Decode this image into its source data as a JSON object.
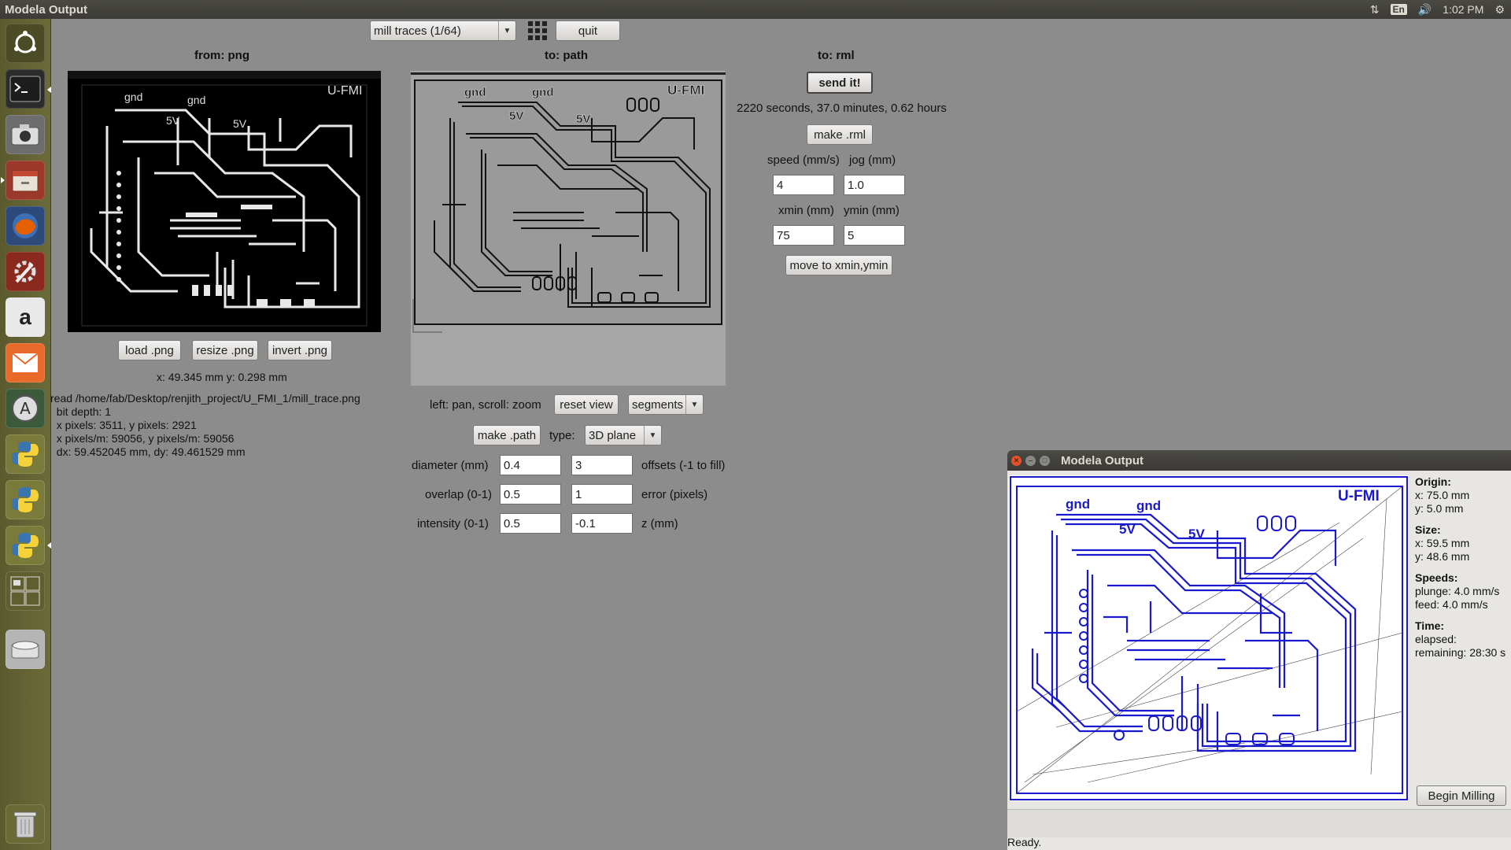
{
  "topbar": {
    "window_title": "Modela Output",
    "network_icon": "network-icon",
    "keyboard_layout": "En",
    "volume_icon": "volume-icon",
    "clock": "1:02 PM",
    "gear_icon": "gear-icon"
  },
  "launcher": {
    "items": [
      "dash-home",
      "terminal",
      "screenshot",
      "files",
      "firefox",
      "system-settings",
      "amazon",
      "mail",
      "software-updater",
      "python",
      "python",
      "python",
      "workspace-switcher",
      "drive",
      "trash"
    ]
  },
  "toolbar": {
    "process_select": "mill traces (1/64)",
    "quit_label": "quit"
  },
  "from_png": {
    "heading": "from: png",
    "load_label": "load .png",
    "resize_label": "resize .png",
    "invert_label": "invert .png",
    "coords": "x: 49.345 mm  y: 0.298 mm",
    "file_info": [
      "read /home/fab/Desktop/renjith_project/U_FMI_1/mill_trace.png",
      "  bit depth: 1",
      "  x pixels: 3511, y pixels: 2921",
      "  x pixels/m: 59056, y pixels/m: 59056",
      "  dx: 59.452045 mm, dy: 49.461529 mm"
    ],
    "board_labels": {
      "gnd1": "gnd",
      "gnd2": "gnd",
      "v1": "5V",
      "v2": "5V",
      "brand": "U-FMI"
    }
  },
  "to_path": {
    "heading": "to: path",
    "nav_hint": "left: pan, scroll: zoom",
    "reset_view_label": "reset view",
    "view_mode": "segments",
    "make_path_label": "make .path",
    "type_label": "type:",
    "type_value": "3D plane",
    "diameter_label": "diameter (mm)",
    "diameter_value": "0.4",
    "offsets_value": "3",
    "offsets_label": "offsets (-1 to fill)",
    "overlap_label": "overlap (0-1)",
    "overlap_value": "0.5",
    "error_value": "1",
    "error_label": "error (pixels)",
    "intensity_label": "intensity (0-1)",
    "intensity_value": "0.5",
    "z_value": "-0.1",
    "z_label": "z (mm)",
    "board_labels": {
      "gnd1": "gnd",
      "gnd2": "gnd",
      "v1": "5V",
      "v2": "5V",
      "brand": "U-FMI"
    }
  },
  "to_rml": {
    "heading": "to: rml",
    "send_label": "send it!",
    "time_estimate": "2220 seconds, 37.0 minutes, 0.62 hours",
    "make_rml_label": "make .rml",
    "speed_label": "speed (mm/s)",
    "jog_label": "jog (mm)",
    "speed_value": "4",
    "jog_value": "1.0",
    "xmin_label": "xmin (mm)",
    "ymin_label": "ymin (mm)",
    "xmin_value": "75",
    "ymin_value": "5",
    "move_label": "move to xmin,ymin"
  },
  "output_window": {
    "title": "Modela Output",
    "origin_heading": "Origin:",
    "origin_x": "x: 75.0 mm",
    "origin_y": "y: 5.0 mm",
    "size_heading": "Size:",
    "size_x": "x: 59.5 mm",
    "size_y": "y: 48.6 mm",
    "speeds_heading": "Speeds:",
    "plunge": "plunge: 4.0 mm/s",
    "feed": "feed: 4.0 mm/s",
    "time_heading": "Time:",
    "elapsed": "elapsed:",
    "remaining": "remaining: 28:30 s",
    "begin_label": "Begin Milling",
    "status": "Ready.",
    "board_labels": {
      "gnd1": "gnd",
      "gnd2": "gnd",
      "v1": "5V",
      "v2": "5V",
      "brand": "U-FMI"
    },
    "toolpath_color": "#1a1acc"
  }
}
